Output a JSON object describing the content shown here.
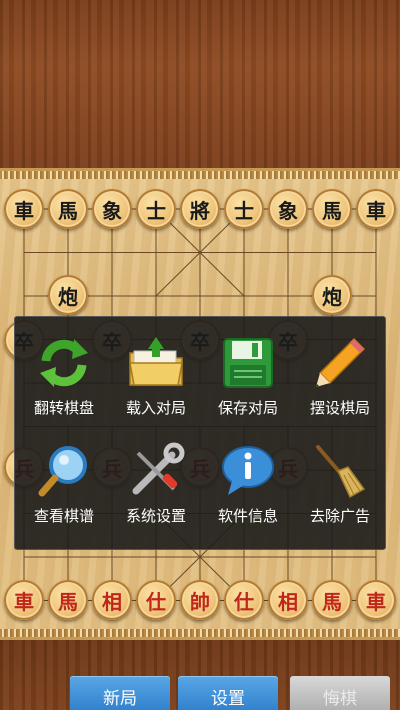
{
  "board": {
    "black_back_row": [
      "車",
      "馬",
      "象",
      "士",
      "將",
      "士",
      "象",
      "馬",
      "車"
    ],
    "black_cannon_left": "炮",
    "black_cannon_right": "炮",
    "black_pawns_visible": [
      "卒",
      "卒",
      "卒",
      "卒"
    ],
    "red_pawns_visible": [
      "兵",
      "兵",
      "兵",
      "兵"
    ],
    "red_back_row": [
      "車",
      "馬",
      "相",
      "仕",
      "帥",
      "仕",
      "相",
      "馬",
      "車"
    ]
  },
  "menu": {
    "items": [
      {
        "label": "翻转棋盘",
        "icon": "refresh-arrows-icon"
      },
      {
        "label": "载入对局",
        "icon": "folder-upload-icon"
      },
      {
        "label": "保存对局",
        "icon": "floppy-disk-icon"
      },
      {
        "label": "摆设棋局",
        "icon": "pencil-icon"
      },
      {
        "label": "查看棋谱",
        "icon": "magnifier-icon"
      },
      {
        "label": "系统设置",
        "icon": "tools-icon"
      },
      {
        "label": "软件信息",
        "icon": "info-icon"
      },
      {
        "label": "去除广告",
        "icon": "broom-icon"
      }
    ]
  },
  "bottom_bar": {
    "new_game": "新局",
    "settings": "设置",
    "undo": "悔棋"
  },
  "colors": {
    "black_piece_text": "#1a1a1a",
    "red_piece_text": "#c0271b",
    "button_blue": "#2b7bc9"
  }
}
